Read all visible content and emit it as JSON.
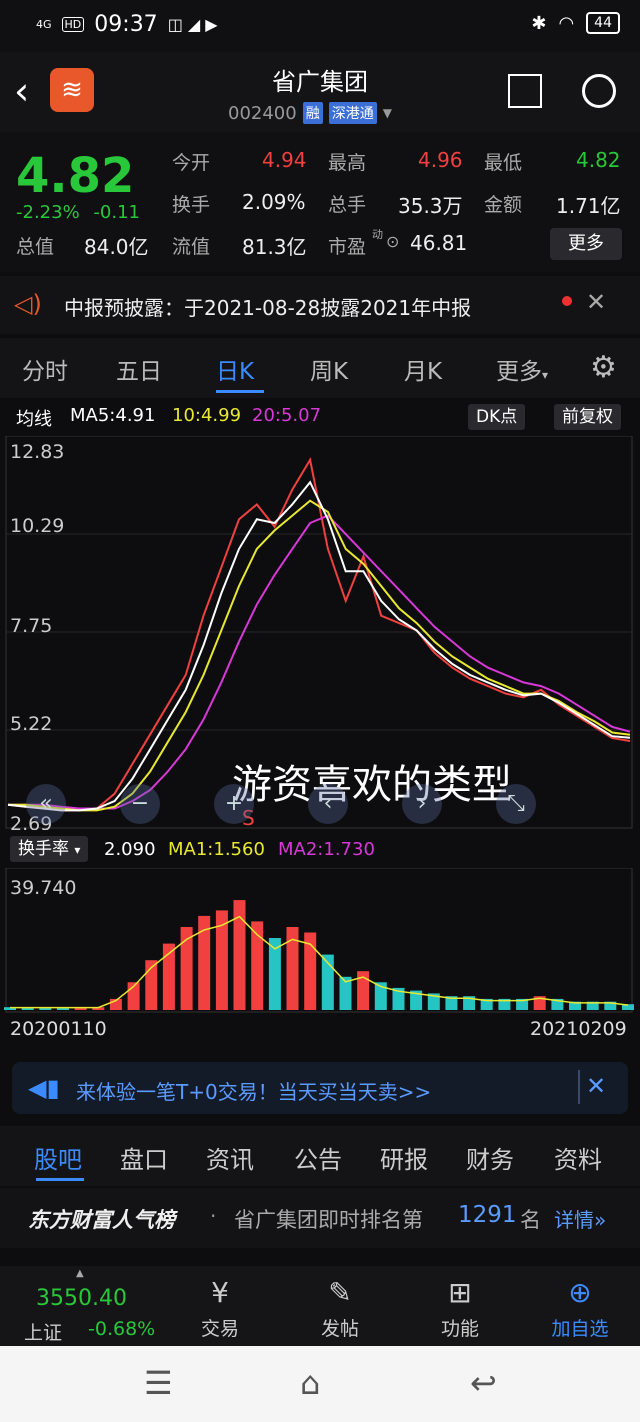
{
  "status_bar": {
    "signal": "4G",
    "hd": "HD",
    "time": "09:37",
    "battery": "44"
  },
  "header": {
    "title": "省广集团",
    "code": "002400",
    "badge1": "融",
    "badge2": "深港通"
  },
  "quote": {
    "price": "4.82",
    "change_pct": "-2.23%",
    "change_abs": "-0.11",
    "open_label": "今开",
    "open": "4.94",
    "high_label": "最高",
    "high": "4.96",
    "low_label": "最低",
    "low": "4.82",
    "turnover_label": "换手",
    "turnover": "2.09%",
    "volume_label": "总手",
    "volume": "35.3万",
    "amount_label": "金额",
    "amount": "1.71亿",
    "mktcap_label": "总值",
    "mktcap": "84.0亿",
    "float_label": "流值",
    "float": "81.3亿",
    "pe_label": "市盈",
    "pe_sup": "动",
    "pe": "46.81",
    "more": "更多"
  },
  "notice": {
    "text": "中报预披露：于2021-08-28披露2021年中报"
  },
  "period_tabs": [
    "分时",
    "五日",
    "日K",
    "周K",
    "月K",
    "更多"
  ],
  "ma": {
    "label": "均线",
    "ma5": "MA5:4.91",
    "ma10": "10:4.99",
    "ma20": "20:5.07",
    "dk": "DK点",
    "adjust": "前复权"
  },
  "price_axis": [
    "12.83",
    "10.29",
    "7.75",
    "5.22",
    "2.69"
  ],
  "overlay_text": "游资喜欢的类型",
  "markers": {
    "sell": "S"
  },
  "chart_controls": [
    "«",
    "−",
    "+",
    "‹",
    "›",
    "⤡"
  ],
  "turnover": {
    "label": "换手率",
    "value": "2.090",
    "ma1": "MA1:1.560",
    "ma2": "MA2:1.730",
    "max": "39.740"
  },
  "dates": {
    "start": "20200110",
    "end": "20210209"
  },
  "promo": {
    "text": "来体验一笔T+0交易！当天买当天卖>>"
  },
  "section_tabs": [
    "股吧",
    "盘口",
    "资讯",
    "公告",
    "研报",
    "财务",
    "资料"
  ],
  "rank": {
    "brand": "东方财富人气榜",
    "text": "省广集团即时排名第",
    "num": "1291",
    "unit": "名",
    "details": "详情"
  },
  "index": {
    "value": "3550.40",
    "name": "上证",
    "change": "-0.68%"
  },
  "bottom_nav": [
    {
      "label": "交易"
    },
    {
      "label": "发帖"
    },
    {
      "label": "功能"
    },
    {
      "label": "加自选"
    }
  ],
  "colors": {
    "up": "#f04040",
    "down": "#28c83a",
    "accent": "#3b8bff",
    "ma5": "#ffffff",
    "ma10": "#e8e830",
    "ma20": "#d838d8"
  },
  "chart_data": {
    "type": "line",
    "ylim": [
      2.69,
      12.83
    ],
    "close": [
      3.1,
      3.05,
      3.0,
      2.95,
      2.95,
      3.0,
      3.4,
      4.2,
      5.0,
      5.8,
      6.6,
      8.2,
      9.5,
      10.8,
      11.2,
      10.6,
      11.6,
      12.4,
      10.0,
      8.6,
      9.8,
      8.2,
      8.0,
      7.8,
      7.2,
      6.8,
      6.5,
      6.3,
      6.1,
      6.0,
      6.2,
      5.8,
      5.5,
      5.2,
      4.9,
      4.82
    ],
    "ma5": [
      3.1,
      3.05,
      3.0,
      2.95,
      2.95,
      3.0,
      3.2,
      3.8,
      4.6,
      5.4,
      6.2,
      7.4,
      8.8,
      10.0,
      10.8,
      10.7,
      11.2,
      11.8,
      10.8,
      9.4,
      9.4,
      8.6,
      8.1,
      7.8,
      7.3,
      6.9,
      6.6,
      6.4,
      6.2,
      6.05,
      6.1,
      5.85,
      5.55,
      5.25,
      4.95,
      4.91
    ],
    "ma10": [
      3.1,
      3.1,
      3.05,
      3.0,
      2.95,
      2.95,
      3.05,
      3.4,
      4.0,
      4.8,
      5.6,
      6.6,
      7.8,
      9.0,
      10.0,
      10.5,
      10.9,
      11.3,
      11.0,
      10.0,
      9.6,
      9.0,
      8.4,
      8.0,
      7.5,
      7.1,
      6.8,
      6.5,
      6.3,
      6.1,
      6.1,
      5.9,
      5.6,
      5.35,
      5.05,
      4.99
    ],
    "ma20": [
      3.1,
      3.1,
      3.1,
      3.05,
      3.0,
      3.0,
      3.0,
      3.2,
      3.5,
      4.0,
      4.6,
      5.4,
      6.4,
      7.5,
      8.5,
      9.3,
      10.0,
      10.7,
      10.9,
      10.4,
      9.9,
      9.4,
      8.9,
      8.4,
      7.9,
      7.5,
      7.1,
      6.8,
      6.6,
      6.4,
      6.3,
      6.1,
      5.8,
      5.5,
      5.2,
      5.07
    ],
    "turnover": [
      1,
      1,
      1,
      1,
      1,
      1,
      4,
      10,
      18,
      24,
      30,
      34,
      36,
      39.7,
      32,
      26,
      30,
      28,
      20,
      12,
      14,
      10,
      8,
      7,
      6,
      5,
      5,
      4,
      4,
      4,
      5,
      4,
      3,
      3,
      3,
      2.09
    ]
  }
}
